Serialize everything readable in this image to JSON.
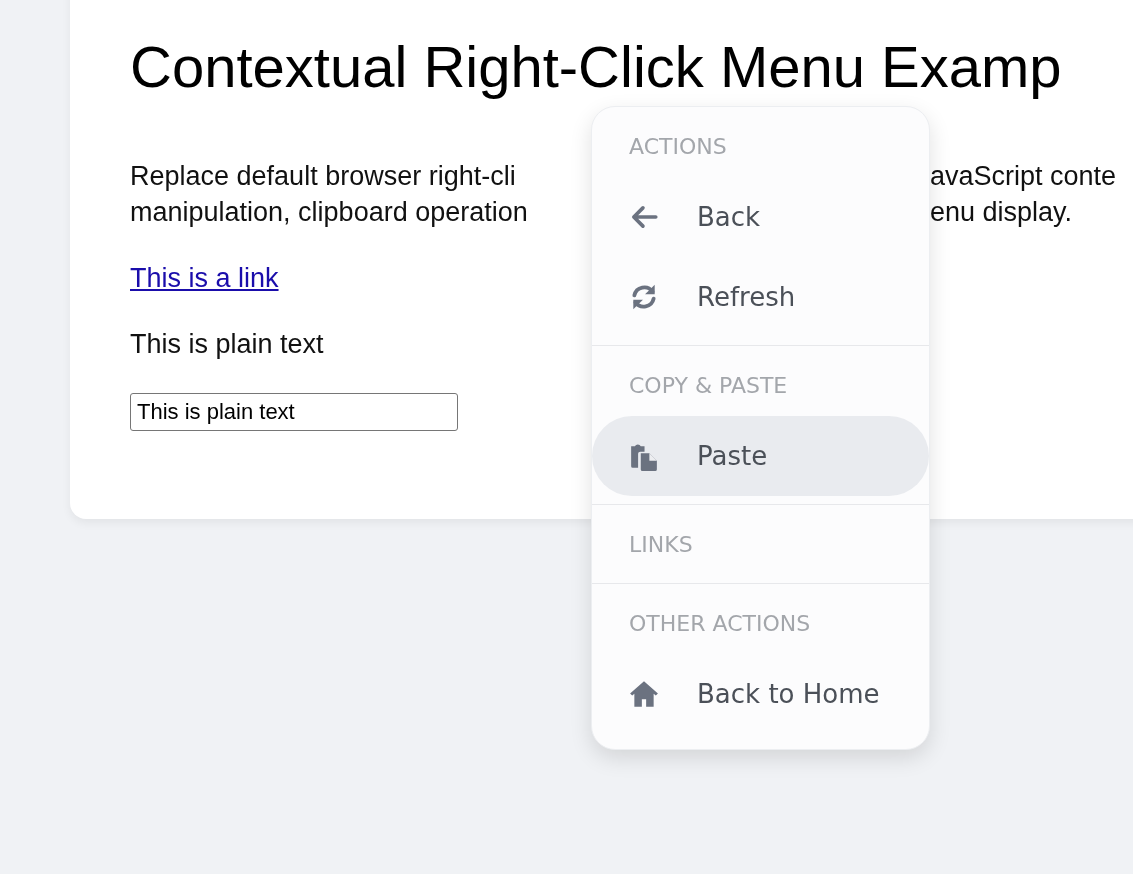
{
  "page": {
    "title": "Contextual Right-Click Menu Examp",
    "paragraph_lines": [
      {
        "left": "Replace default browser right-cli",
        "right": "avaScript conte"
      },
      {
        "left": "manipulation, clipboard operation",
        "right": "enu display."
      }
    ],
    "link": "This is a link",
    "plain_text": "This is plain text",
    "input": {
      "value": "This is plain text"
    }
  },
  "context_menu": {
    "sections": [
      {
        "heading": "ACTIONS",
        "items": [
          {
            "label": "Back",
            "kind": "back",
            "selected": false
          },
          {
            "label": "Refresh",
            "kind": "refresh",
            "selected": false
          }
        ]
      },
      {
        "heading": "COPY & PASTE",
        "items": [
          {
            "label": "Paste",
            "kind": "paste",
            "selected": true
          }
        ]
      },
      {
        "heading": "LINKS"
      },
      {
        "heading": "OTHER ACTIONS",
        "items": [
          {
            "label": "Back to Home",
            "kind": "home",
            "selected": false
          }
        ]
      }
    ]
  }
}
